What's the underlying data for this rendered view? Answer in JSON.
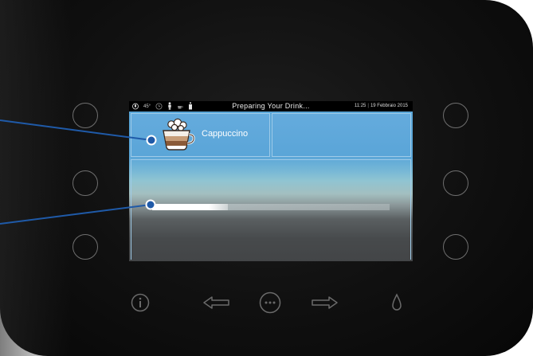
{
  "statusbar": {
    "temperature": "45°",
    "title": "Preparing Your Drink...",
    "time": "11:25",
    "date": "19 Febbraio 2015",
    "icons": [
      "water-temperature-icon",
      "clock-icon",
      "person-icon",
      "cup-icon",
      "bottle-icon"
    ]
  },
  "drink_tile": {
    "label": "Cappuccino",
    "icon": "cappuccino-cup-icon"
  },
  "progress": {
    "value": 0.32
  },
  "bottom_controls": [
    "info-icon",
    "left-arrow-icon",
    "menu-dots-icon",
    "right-arrow-icon",
    "water-drop-icon"
  ],
  "colors": {
    "accent": "#3a6fb0",
    "tile_border": "#9fcbe8",
    "screen_blue": "#5aa6d8"
  }
}
